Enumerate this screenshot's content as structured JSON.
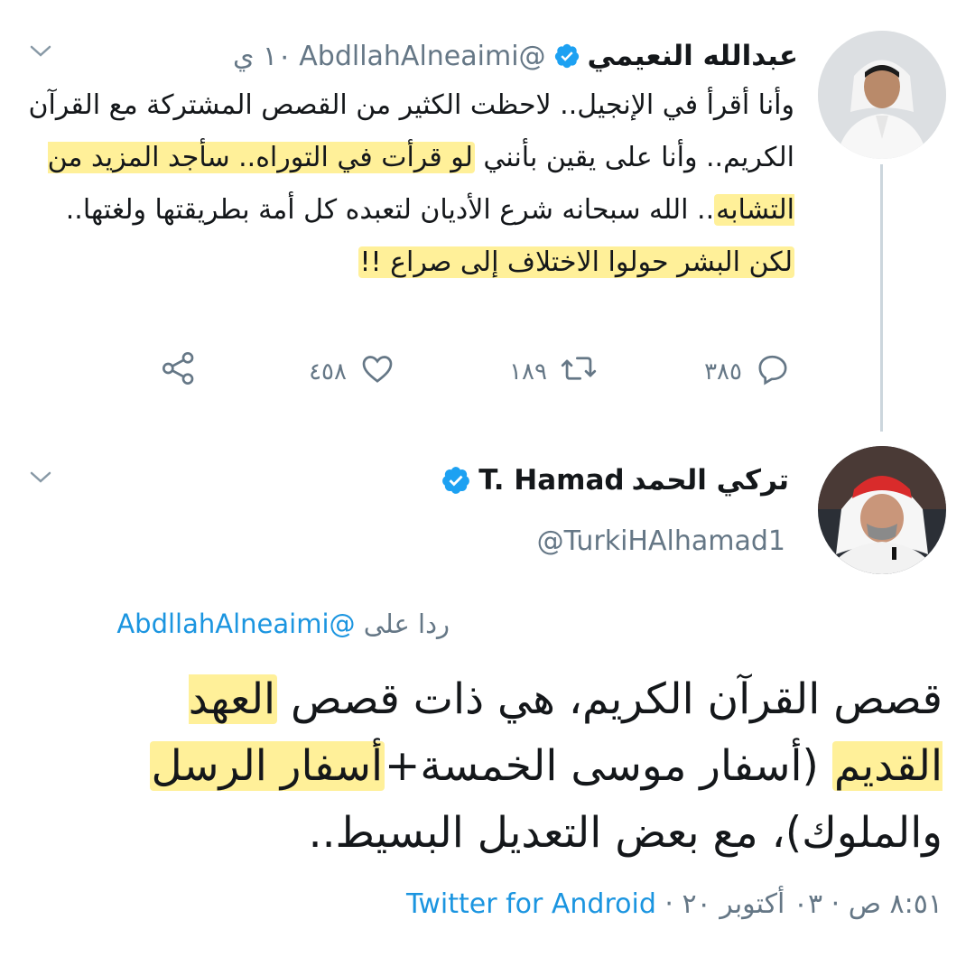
{
  "tweet1": {
    "author_name": "عبدالله النعيمي",
    "handle": "@AbdllahAlneaimi",
    "time": "١٠ ي",
    "text": {
      "p1": "وأنا أقرأ في الإنجيل.. لاحظت الكثير من القصص المشتركة مع القرآن الكريم.. وأنا على يقين بأنني ",
      "h1": "لو قرأت في التوراه.. سأجد المزيد من التشابه",
      "p2": ".. الله سبحانه شرع الأديان لتعبده كل أمة بطريقتها ولغتها.. ",
      "h2": "لكن البشر حولوا الاختلاف إلى صراع !!"
    },
    "replies": "٣٨٥",
    "retweets": "١٨٩",
    "likes": "٤٥٨"
  },
  "tweet2": {
    "author_name": "تركي الحمد",
    "author_name_latin": "T. Hamad",
    "handle": "@TurkiHAlhamad1",
    "reply_label": "ردا على",
    "reply_mention": "@AbdllahAlneaimi",
    "text": {
      "p1": "قصص القرآن الكريم، هي ذات قصص ",
      "h1": "العهد القديم",
      "p2": " (أسفار موسى الخمسة+",
      "h2": "أسفار الرسل",
      "p3": " والملوك)، مع بعض التعديل البسيط.."
    },
    "timestamp": "٨:٥١ ص · ٠٣ أكتوبر ٢٠",
    "source_sep": "·",
    "source": "Twitter for Android"
  },
  "colors": {
    "verified": "#1da1f2",
    "link": "#1b95e0",
    "muted": "#657786",
    "highlight": "#ffe96e"
  }
}
